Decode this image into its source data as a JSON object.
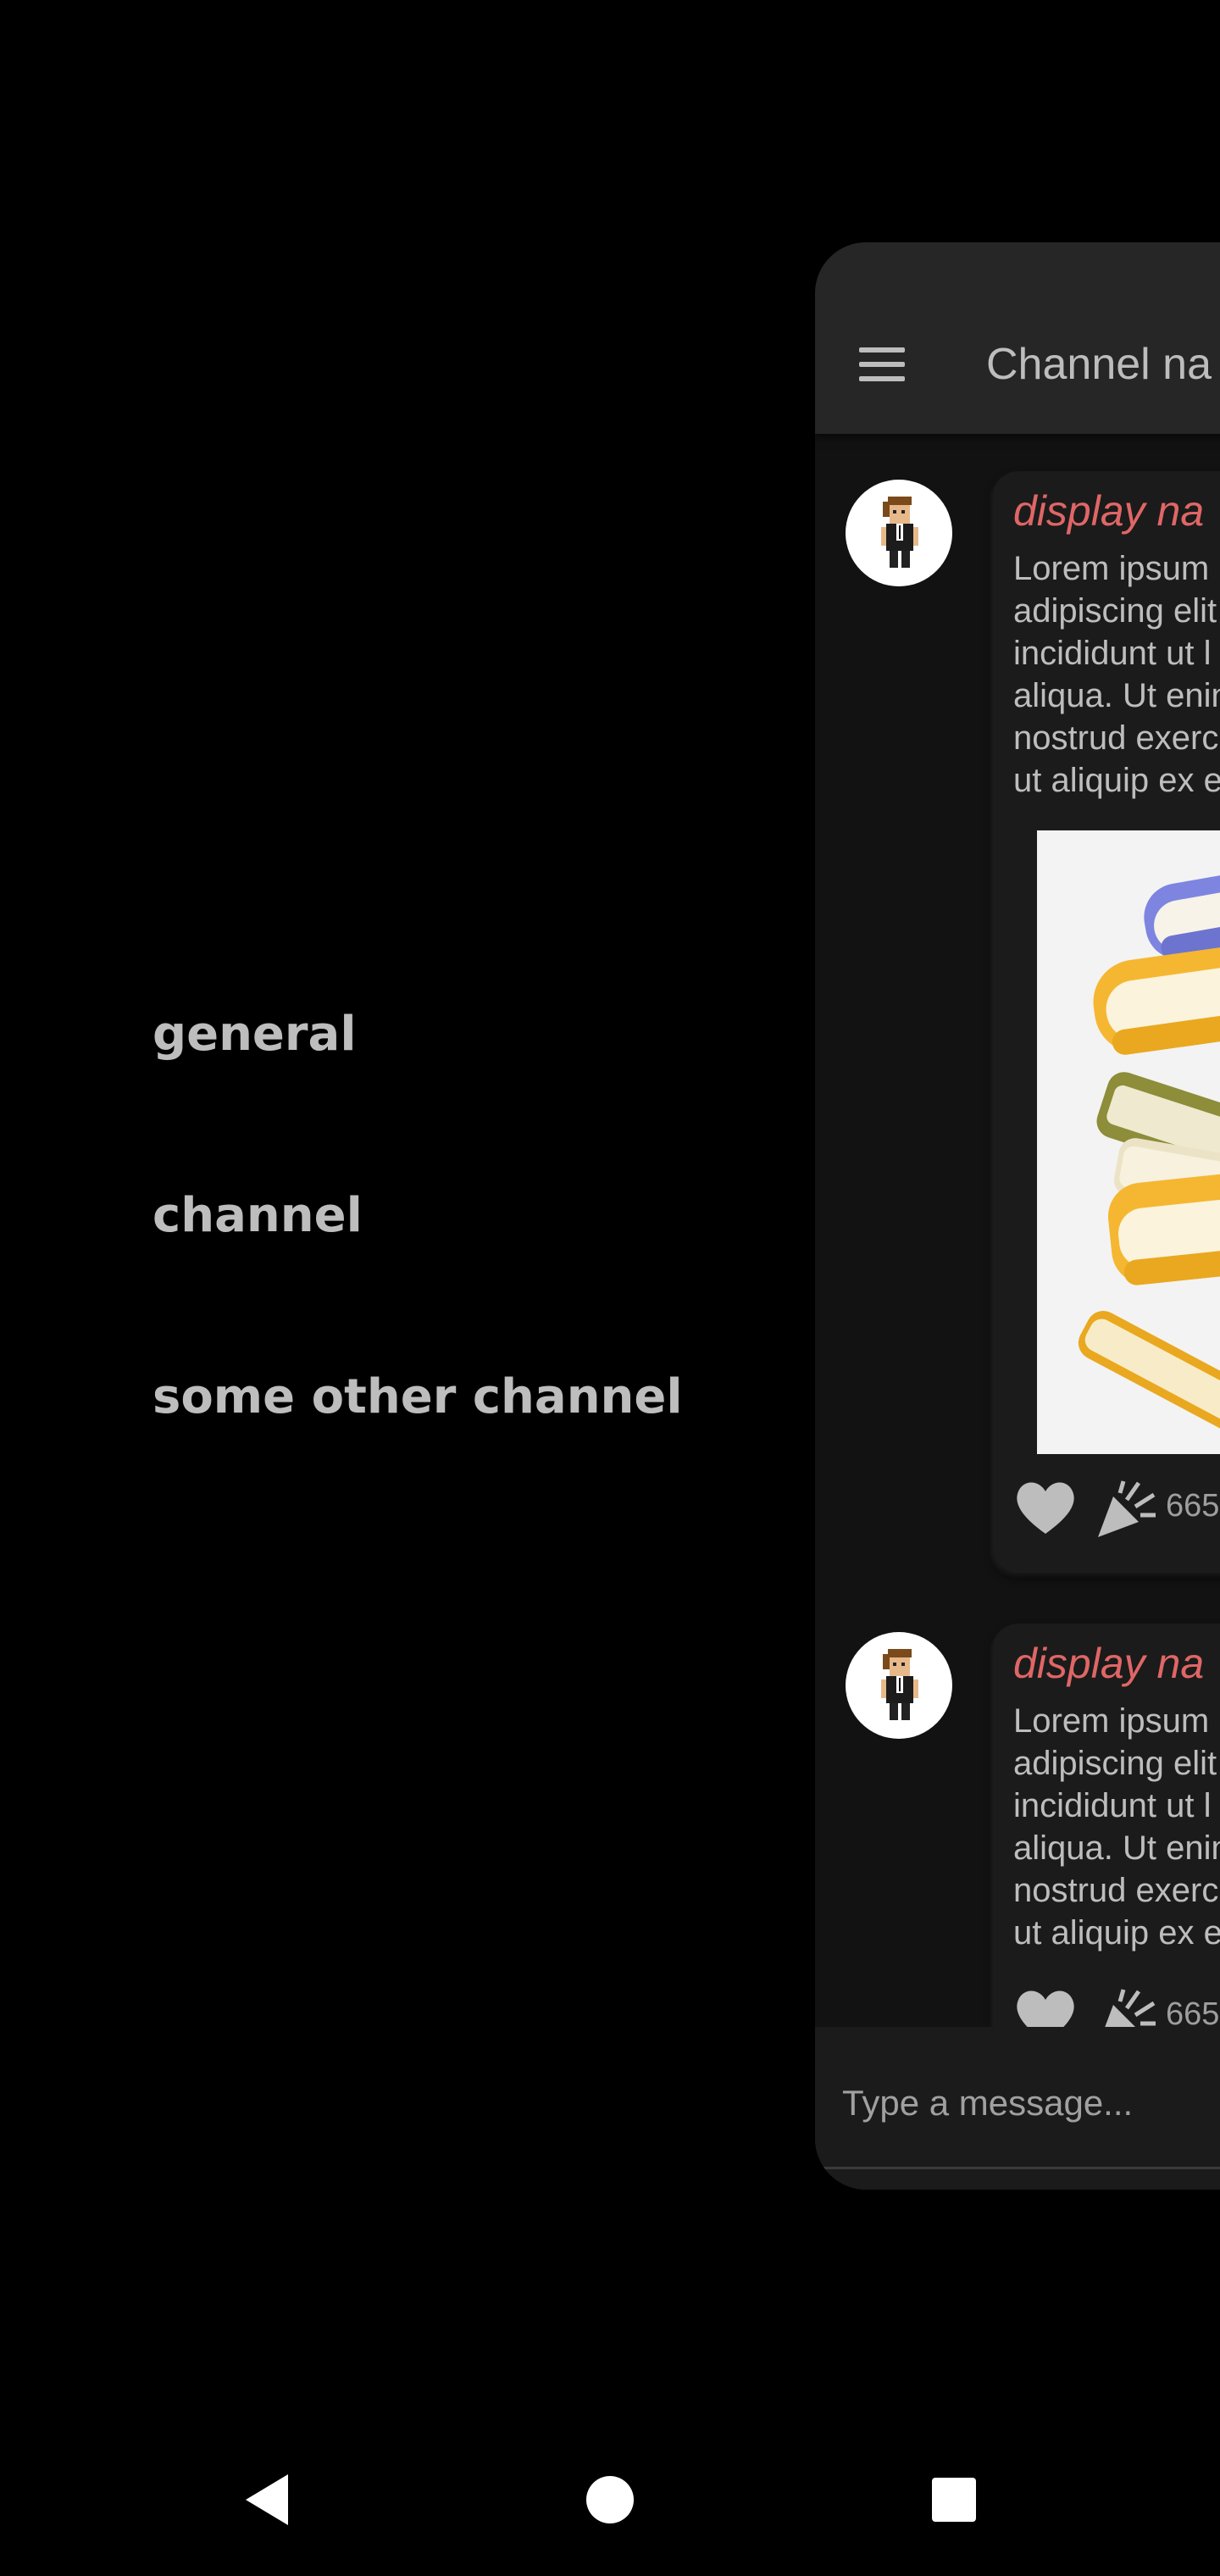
{
  "drawer": {
    "channels": [
      {
        "label": "general"
      },
      {
        "label": "channel"
      },
      {
        "label": "some other channel"
      }
    ]
  },
  "chat": {
    "title": "Channel na",
    "messages": [
      {
        "display_name": "display na",
        "lines": [
          "Lorem ipsum",
          "adipiscing elit",
          "incididunt ut l",
          "aliqua. Ut enin",
          "nostrud exerc",
          "ut aliquip ex e"
        ],
        "reaction_count": "665"
      },
      {
        "display_name": "display na",
        "lines": [
          "Lorem ipsum",
          "adipiscing elit",
          "incididunt ut l",
          "aliqua. Ut enin",
          "nostrud exerc",
          "ut aliquip ex e"
        ],
        "reaction_count": "665"
      }
    ],
    "composer": {
      "placeholder": "Type a message..."
    }
  },
  "icons": {
    "menu": "menu-icon",
    "heart": "heart-icon",
    "party": "party-popper-icon",
    "back": "back-triangle-icon",
    "home": "home-circle-icon",
    "recents": "recents-square-icon"
  },
  "colors": {
    "display_name": "#e06666",
    "text": "#bdbdbd",
    "background": "#000000",
    "card": "#121212",
    "app_bar": "#262626"
  }
}
